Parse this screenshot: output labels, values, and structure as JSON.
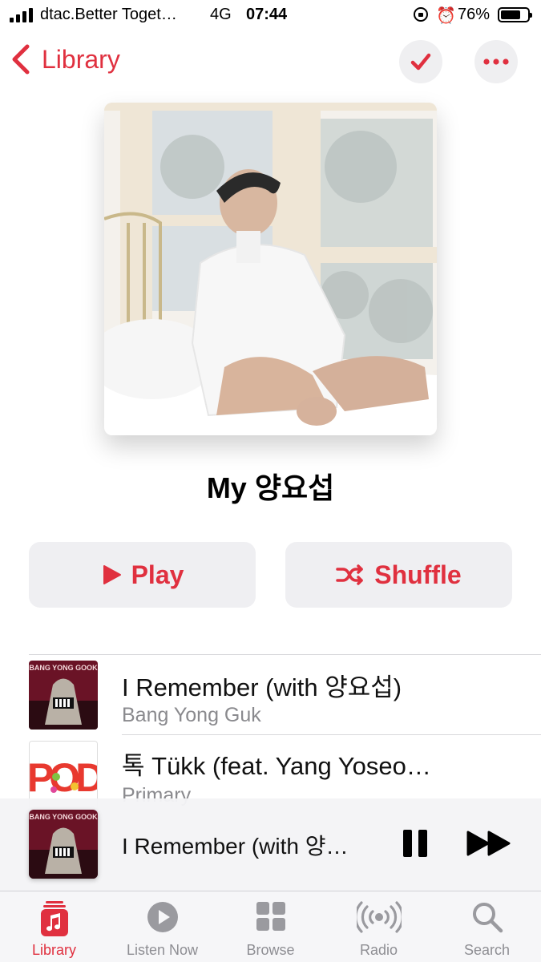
{
  "status_bar": {
    "carrier": "dtac.Better Toget…",
    "network": "4G",
    "time": "07:44",
    "battery_text": "76%",
    "battery_level": 0.76
  },
  "nav": {
    "back_label": "Library"
  },
  "playlist": {
    "title": "My 양요섭"
  },
  "actions": {
    "play_label": "Play",
    "shuffle_label": "Shuffle"
  },
  "tracks": [
    {
      "title": "I Remember (with 양요섭)",
      "artist": "Bang Yong Guk",
      "art_text": "BANG YONG GOOK"
    },
    {
      "title": "톡 Tükk (feat. Yang Yoseo…",
      "artist": "Primary",
      "art_text": "POD"
    }
  ],
  "now_playing": {
    "title": "I Remember (with 양…",
    "art_text": "BANG YONG GOOK"
  },
  "tabs": [
    {
      "label": "Library",
      "icon": "library-icon",
      "active": true
    },
    {
      "label": "Listen Now",
      "icon": "listen-now-icon",
      "active": false
    },
    {
      "label": "Browse",
      "icon": "browse-icon",
      "active": false
    },
    {
      "label": "Radio",
      "icon": "radio-icon",
      "active": false
    },
    {
      "label": "Search",
      "icon": "search-icon",
      "active": false
    }
  ],
  "colors": {
    "accent": "#e0303f",
    "button_bg": "#efeff2",
    "secondary_text": "#8a8a8e",
    "tab_inactive": "#8e8e93"
  }
}
